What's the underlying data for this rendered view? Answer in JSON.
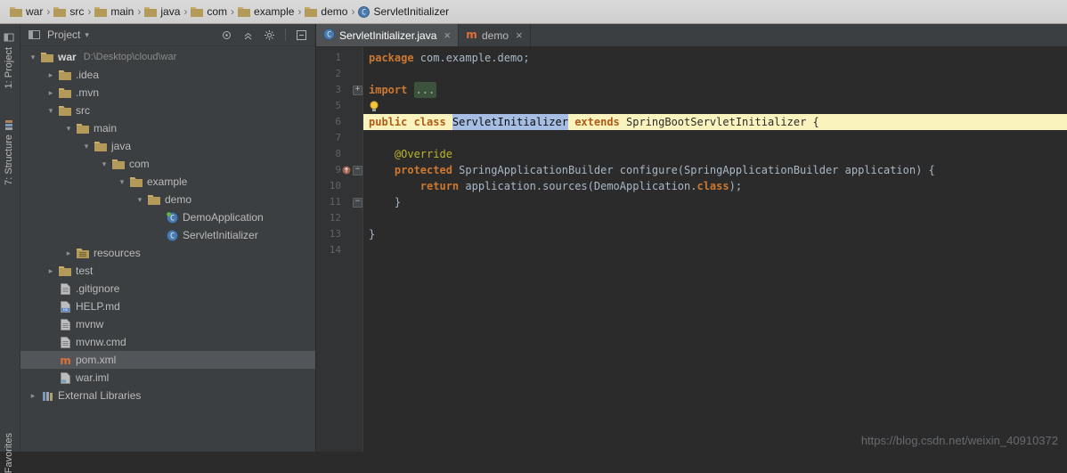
{
  "topbar": {
    "separator": "›",
    "items": [
      {
        "label": "war",
        "icon": "folder"
      },
      {
        "label": "src",
        "icon": "folder"
      },
      {
        "label": "main",
        "icon": "folder"
      },
      {
        "label": "java",
        "icon": "folder"
      },
      {
        "label": "com",
        "icon": "folder"
      },
      {
        "label": "example",
        "icon": "folder"
      },
      {
        "label": "demo",
        "icon": "folder"
      },
      {
        "label": "ServletInitializer",
        "icon": "class"
      }
    ]
  },
  "tool_strip": {
    "project": "1: Project",
    "structure": "7: Structure",
    "favorites": "Favorites"
  },
  "project_panel": {
    "title": "Project",
    "caret": "▾",
    "tree": [
      {
        "label": "war",
        "suffix": "D:\\Desktop\\cloud\\war",
        "level": 0,
        "expand": "open",
        "icon": "folder",
        "bold": true
      },
      {
        "label": ".idea",
        "level": 1,
        "expand": "closed",
        "icon": "folder"
      },
      {
        "label": ".mvn",
        "level": 1,
        "expand": "closed",
        "icon": "folder"
      },
      {
        "label": "src",
        "level": 1,
        "expand": "open",
        "icon": "folder"
      },
      {
        "label": "main",
        "level": 2,
        "expand": "open",
        "icon": "folder"
      },
      {
        "label": "java",
        "level": 3,
        "expand": "open",
        "icon": "folder"
      },
      {
        "label": "com",
        "level": 4,
        "expand": "open",
        "icon": "folder"
      },
      {
        "label": "example",
        "level": 5,
        "expand": "open",
        "icon": "folder"
      },
      {
        "label": "demo",
        "level": 6,
        "expand": "open",
        "icon": "folder"
      },
      {
        "label": "DemoApplication",
        "level": 7,
        "expand": "none",
        "icon": "class-spring"
      },
      {
        "label": "ServletInitializer",
        "level": 7,
        "expand": "none",
        "icon": "class"
      },
      {
        "label": "resources",
        "level": 2,
        "expand": "closed",
        "icon": "folder-res"
      },
      {
        "label": "test",
        "level": 1,
        "expand": "closed",
        "icon": "folder"
      },
      {
        "label": ".gitignore",
        "level": 1,
        "expand": "none",
        "icon": "file"
      },
      {
        "label": "HELP.md",
        "level": 1,
        "expand": "none",
        "icon": "file-md"
      },
      {
        "label": "mvnw",
        "level": 1,
        "expand": "none",
        "icon": "file"
      },
      {
        "label": "mvnw.cmd",
        "level": 1,
        "expand": "none",
        "icon": "file"
      },
      {
        "label": "pom.xml",
        "level": 1,
        "expand": "none",
        "icon": "maven",
        "selected": true
      },
      {
        "label": "war.iml",
        "level": 1,
        "expand": "none",
        "icon": "file-iml"
      },
      {
        "label": "External Libraries",
        "level": 0,
        "expand": "closed",
        "icon": "lib"
      }
    ]
  },
  "tabs": {
    "close_glyph": "×",
    "items": [
      {
        "label": "ServletInitializer.java",
        "icon": "class",
        "active": true
      },
      {
        "label": "demo",
        "icon": "maven",
        "active": false
      }
    ]
  },
  "editor": {
    "glyphs": {
      "expanded": "▾",
      "collapsed": "▸",
      "fold_open": "−",
      "fold_closed": "+"
    },
    "lines": [
      {
        "num": "1",
        "seg": [
          [
            "package ",
            "kw"
          ],
          [
            "com.example.demo;",
            "pl"
          ]
        ]
      },
      {
        "num": "2",
        "seg": []
      },
      {
        "num": "3",
        "fold": "plus",
        "seg": [
          [
            "import ",
            "kw"
          ],
          [
            "...",
            "fold"
          ]
        ]
      },
      {
        "num": "5",
        "bulb": true,
        "seg": []
      },
      {
        "num": "6",
        "hl": true,
        "seg": [
          [
            "public class ",
            "kw6"
          ],
          [
            "ServletInitializer",
            "sel6"
          ],
          [
            " ",
            "pl6"
          ],
          [
            "extends ",
            "kw6"
          ],
          [
            "SpringBootServletInitializer {",
            "pl6"
          ]
        ]
      },
      {
        "num": "7",
        "seg": []
      },
      {
        "num": "8",
        "seg": [
          [
            "    ",
            "pl"
          ],
          [
            "@Override",
            "ann"
          ]
        ]
      },
      {
        "num": "9",
        "fold": "minus",
        "marker": "override",
        "seg": [
          [
            "    ",
            "pl"
          ],
          [
            "protected ",
            "kw"
          ],
          [
            "SpringApplicationBuilder configure(SpringApplicationBuilder application) {",
            "pl"
          ]
        ]
      },
      {
        "num": "10",
        "seg": [
          [
            "        ",
            "pl"
          ],
          [
            "return ",
            "kw"
          ],
          [
            "application.sources(DemoApplication.",
            "pl"
          ],
          [
            "class",
            "kw"
          ],
          [
            ");",
            "pl"
          ]
        ]
      },
      {
        "num": "11",
        "fold": "minus",
        "seg": [
          [
            "    }",
            "pl"
          ]
        ]
      },
      {
        "num": "12",
        "seg": []
      },
      {
        "num": "13",
        "seg": [
          [
            "}",
            "pl"
          ]
        ]
      },
      {
        "num": "14",
        "seg": []
      }
    ]
  },
  "watermark": "https://blog.csdn.net/weixin_40910372",
  "colors": {
    "keyword": "#cc7832",
    "panel_bg": "#3c3f41",
    "editor_bg": "#2b2b2b",
    "line_highlight": "#fbf3bd",
    "occurrence_selection": "#a6bde4",
    "tree_selection": "#52565a"
  }
}
